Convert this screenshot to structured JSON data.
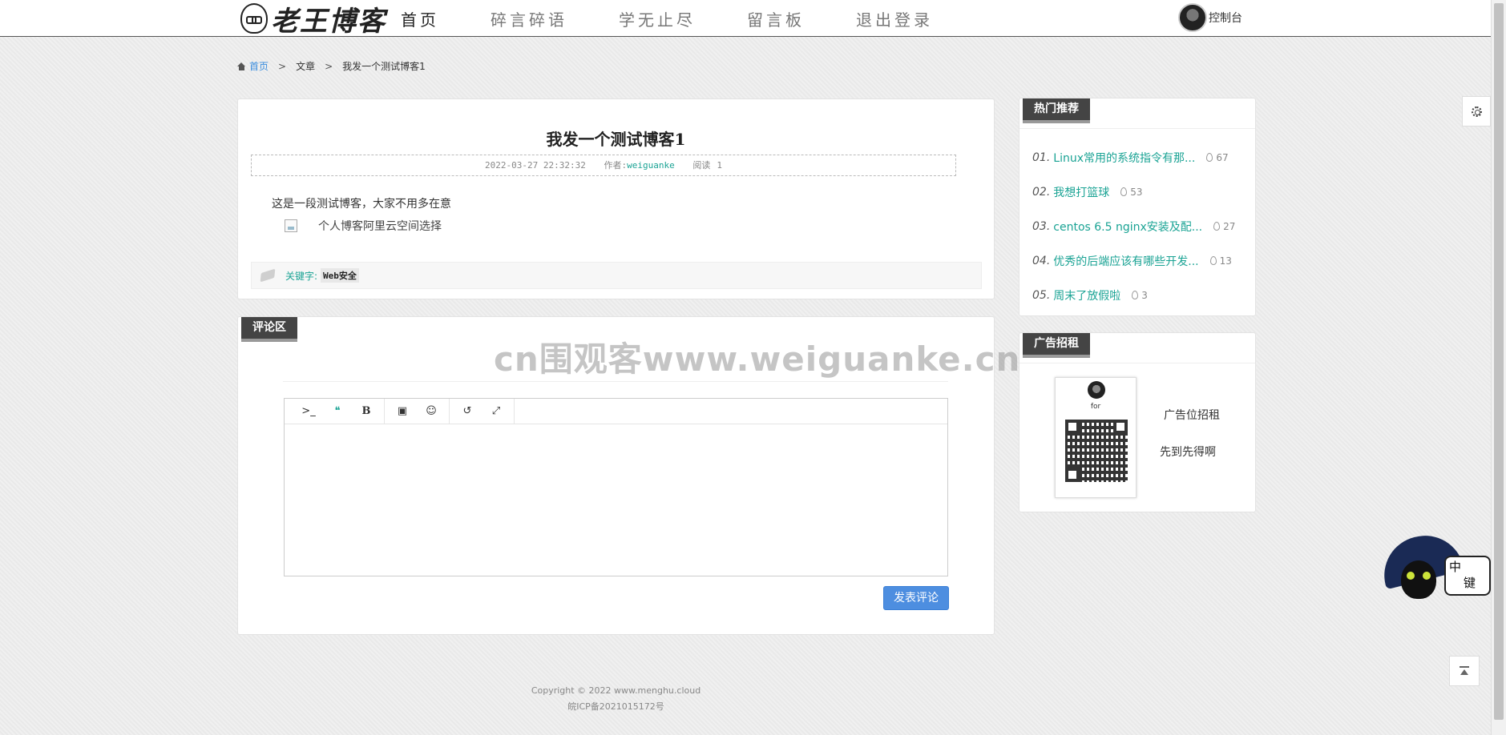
{
  "header": {
    "logo_text": "老王博客",
    "nav": [
      "首页",
      "碎言碎语",
      "学无止尽",
      "留言板",
      "退出登录"
    ],
    "console_label": "控制台"
  },
  "breadcrumb": {
    "items": [
      "首页",
      "文章",
      "我发一个测试博客1"
    ],
    "separator": ">"
  },
  "article": {
    "title": "我发一个测试博客1",
    "date": "2022-03-27 22:32:32",
    "author_label": "作者:",
    "author": "weiguanke",
    "read_label": "阅读",
    "read_count": "1",
    "body": "这是一段测试博客，大家不用多在意",
    "image_alt": "个人博客阿里云空间选择",
    "keywords_label": "关键字:",
    "keyword": "Web安全"
  },
  "comments": {
    "title": "评论区",
    "toolbar": [
      {
        "icon": "terminal-icon",
        "glyph": ">_"
      },
      {
        "icon": "quote-icon",
        "glyph": "❝"
      },
      {
        "icon": "bold-icon",
        "glyph": "B"
      },
      {
        "icon": "image-icon",
        "glyph": "▣"
      },
      {
        "icon": "emoji-icon",
        "glyph": "☺"
      },
      {
        "icon": "undo-icon",
        "glyph": "↺"
      },
      {
        "icon": "fullscreen-icon",
        "glyph": "⤢"
      }
    ],
    "submit_label": "发表评论"
  },
  "watermark": "cn围观客www.weiguanke.cn",
  "sidebar": {
    "hot_title": "热门推荐",
    "hot_items": [
      {
        "num": "01.",
        "title": "Linux常用的系统指令有那...",
        "count": "67"
      },
      {
        "num": "02.",
        "title": "我想打篮球",
        "count": "53"
      },
      {
        "num": "03.",
        "title": "centos 6.5 nginx安装及配...",
        "count": "27"
      },
      {
        "num": "04.",
        "title": "优秀的后端应该有哪些开发...",
        "count": "13"
      },
      {
        "num": "05.",
        "title": "周末了放假啦",
        "count": "3"
      }
    ],
    "ad_title": "广告招租",
    "ad_card_name": "for",
    "ad_line1": "广告位招租",
    "ad_line2": "先到先得啊"
  },
  "ime": {
    "char1": "中",
    "char2": "键"
  },
  "footer": {
    "copyright": "Copyright © 2022 www.menghu.cloud",
    "icp": "皖ICP备2021015172号"
  },
  "colors": {
    "accent": "#1aa394",
    "link": "#3a8dde",
    "button": "#4d8ee0"
  }
}
